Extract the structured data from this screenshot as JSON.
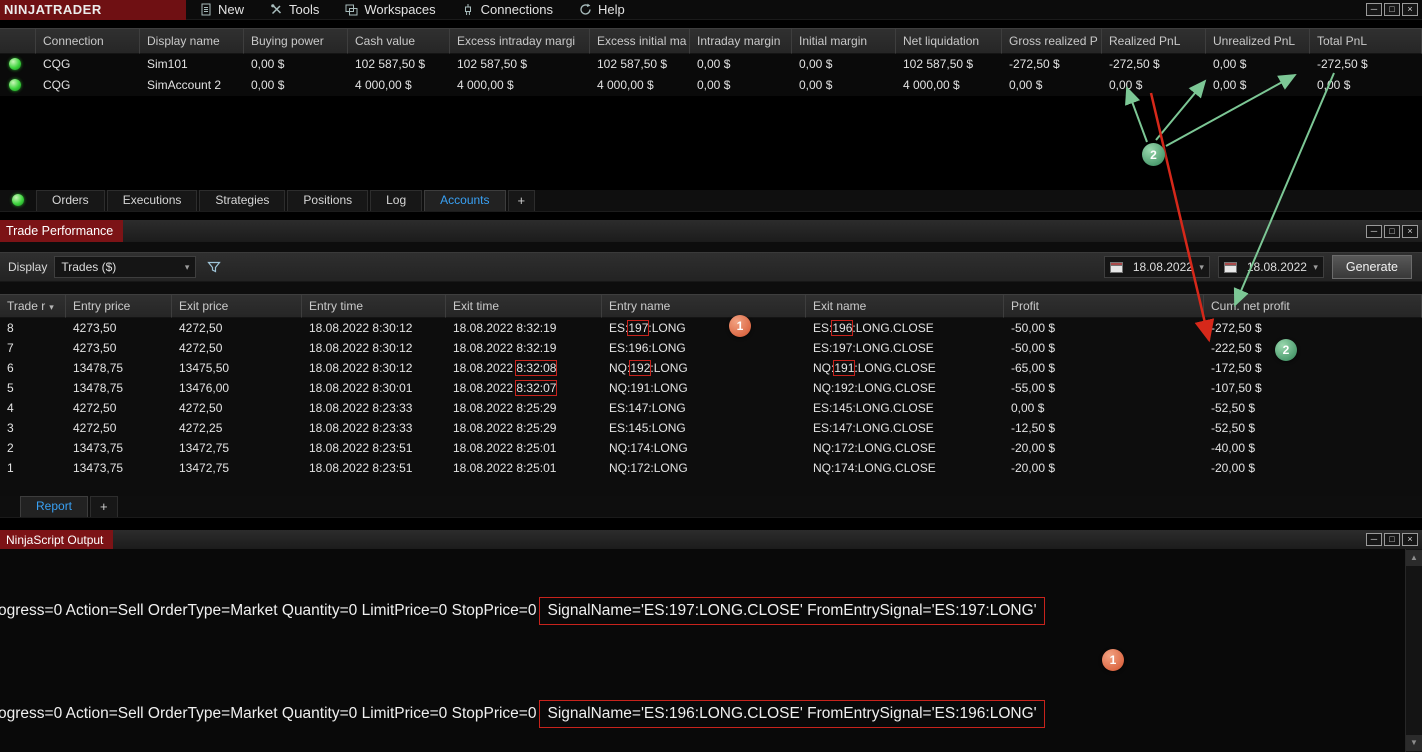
{
  "menu_bar": {
    "logo": "NINJATRADER",
    "items": [
      {
        "label": "New",
        "icon": "new-document-icon"
      },
      {
        "label": "Tools",
        "icon": "tools-icon"
      },
      {
        "label": "Workspaces",
        "icon": "workspaces-icon"
      },
      {
        "label": "Connections",
        "icon": "connections-icon"
      },
      {
        "label": "Help",
        "icon": "help-icon"
      }
    ]
  },
  "icons": {
    "chevron_down": "▾",
    "sort_descending": "▾",
    "scroll_up": "▲",
    "scroll_down": "▼",
    "minimize": "─",
    "maximize": "□",
    "close": "×",
    "add_tab": "+"
  },
  "accounts_table": {
    "columns": [
      "Connection",
      "Display name",
      "Buying power",
      "Cash value",
      "Excess intraday margi",
      "Excess initial ma",
      "Intraday margin",
      "Initial margin",
      "Net liquidation",
      "Gross realized P",
      "Realized PnL",
      "Unrealized PnL",
      "Total PnL"
    ],
    "rows": [
      {
        "status": "connected",
        "cells": [
          "CQG",
          "Sim101",
          "0,00 $",
          "102 587,50 $",
          "102 587,50 $",
          "102 587,50 $",
          "0,00 $",
          "0,00 $",
          "102 587,50 $",
          "-272,50 $",
          "-272,50 $",
          "0,00 $",
          "-272,50 $"
        ]
      },
      {
        "status": "connected",
        "cells": [
          "CQG",
          "SimAccount 2",
          "0,00 $",
          "4 000,00 $",
          "4 000,00 $",
          "4 000,00 $",
          "0,00 $",
          "0,00 $",
          "4 000,00 $",
          "0,00 $",
          "0,00 $",
          "0,00 $",
          "0,00 $"
        ]
      }
    ]
  },
  "tabs": {
    "items": [
      {
        "label": "Orders",
        "active": false
      },
      {
        "label": "Executions",
        "active": false
      },
      {
        "label": "Strategies",
        "active": false
      },
      {
        "label": "Positions",
        "active": false
      },
      {
        "label": "Log",
        "active": false
      },
      {
        "label": "Accounts",
        "active": true
      }
    ],
    "add_tab": "+"
  },
  "trade_performance": {
    "title": "Trade Performance",
    "toolbar": {
      "display_label": "Display",
      "display_value": "Trades ($)",
      "date_from": "18.08.2022",
      "date_to": "18.08.2022",
      "generate_label": "Generate"
    },
    "table": {
      "columns": [
        "Trade r",
        "Entry price",
        "Exit price",
        "Entry time",
        "Exit time",
        "Entry name",
        "Exit name",
        "Profit",
        "Cum. net profit"
      ],
      "rows": [
        [
          "8",
          "4273,50",
          "4272,50",
          "18.08.2022 8:30:12",
          "18.08.2022 8:32:19",
          {
            "t": "ES:197:LONG",
            "hl": "197"
          },
          {
            "t": "ES:196:LONG.CLOSE",
            "hl": "196"
          },
          "-50,00 $",
          "-272,50 $"
        ],
        [
          "7",
          "4273,50",
          "4272,50",
          "18.08.2022 8:30:12",
          "18.08.2022 8:32:19",
          "ES:196:LONG",
          "ES:197:LONG.CLOSE",
          "-50,00 $",
          "-222,50 $"
        ],
        [
          "6",
          "13478,75",
          "13475,50",
          "18.08.2022 8:30:12",
          {
            "t": "18.08.2022 8:32:08",
            "hl": "8:32:08"
          },
          {
            "t": "NQ:192:LONG",
            "hl": "192"
          },
          {
            "t": "NQ:191:LONG.CLOSE",
            "hl": "191"
          },
          "-65,00 $",
          "-172,50 $"
        ],
        [
          "5",
          "13478,75",
          "13476,00",
          "18.08.2022 8:30:01",
          {
            "t": "18.08.2022 8:32:07",
            "hl": "8:32:07"
          },
          "NQ:191:LONG",
          "NQ:192:LONG.CLOSE",
          "-55,00 $",
          "-107,50 $"
        ],
        [
          "4",
          "4272,50",
          "4272,50",
          "18.08.2022 8:23:33",
          "18.08.2022 8:25:29",
          "ES:147:LONG",
          "ES:145:LONG.CLOSE",
          "0,00 $",
          "-52,50 $"
        ],
        [
          "3",
          "4272,50",
          "4272,25",
          "18.08.2022 8:23:33",
          "18.08.2022 8:25:29",
          "ES:145:LONG",
          "ES:147:LONG.CLOSE",
          "-12,50 $",
          "-52,50 $"
        ],
        [
          "2",
          "13473,75",
          "13472,75",
          "18.08.2022 8:23:51",
          "18.08.2022 8:25:01",
          "NQ:174:LONG",
          "NQ:172:LONG.CLOSE",
          "-20,00 $",
          "-40,00 $"
        ],
        [
          "1",
          "13473,75",
          "13472,75",
          "18.08.2022 8:23:51",
          "18.08.2022 8:25:01",
          "NQ:172:LONG",
          "NQ:174:LONG.CLOSE",
          "-20,00 $",
          "-20,00 $"
        ]
      ]
    }
  },
  "report_tabs": {
    "items": [
      {
        "label": "Report",
        "active": true
      }
    ],
    "add_tab": "+"
  },
  "ninjascript_output": {
    "title": "NinjaScript Output",
    "lines": [
      {
        "prefix": "ogress=0 Action=Sell OrderType=Market Quantity=0 LimitPrice=0 StopPrice=0 ",
        "boxed": "SignalName='ES:197:LONG.CLOSE' FromEntrySignal='ES:197:LONG'"
      },
      {
        "prefix": "ogress=0 Action=Sell OrderType=Market Quantity=0 LimitPrice=0 StopPrice=0 ",
        "boxed": "SignalName='ES:196:LONG.CLOSE' FromEntrySignal='ES:196:LONG'"
      }
    ]
  },
  "annotations": {
    "badge_1": "1",
    "badge_2": "2"
  },
  "colors": {
    "negative": "#e03131",
    "accent_blue": "#39a1f4",
    "title_chip": "#7c1316",
    "annotation_green": "#7cc795",
    "annotation_red": "#d6281a",
    "annotation_orange": "#dd6b47"
  }
}
